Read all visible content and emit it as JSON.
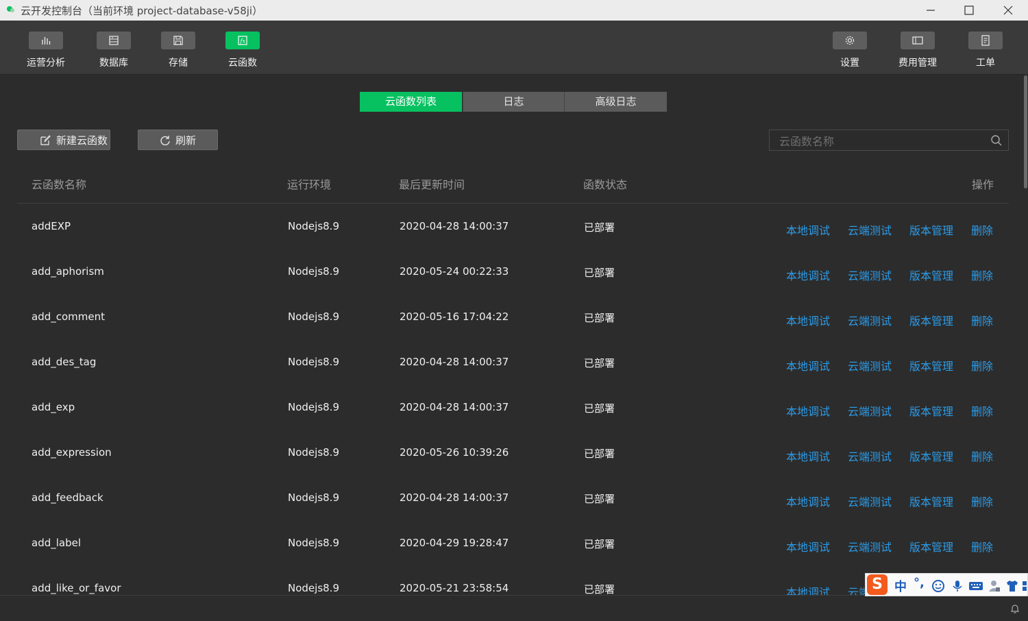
{
  "window": {
    "title": "云开发控制台（当前环境 project-database-v58ji）"
  },
  "toolbar": {
    "left_items": [
      {
        "label": "运营分析",
        "icon": "bar-chart-icon"
      },
      {
        "label": "数据库",
        "icon": "database-icon"
      },
      {
        "label": "存储",
        "icon": "storage-icon"
      },
      {
        "label": "云函数",
        "icon": "function-icon",
        "active": true
      }
    ],
    "right_items": [
      {
        "label": "设置",
        "icon": "gear-icon"
      },
      {
        "label": "费用管理",
        "icon": "billing-icon"
      },
      {
        "label": "工单",
        "icon": "ticket-icon"
      }
    ]
  },
  "tabs": [
    {
      "label": "云函数列表",
      "active": true
    },
    {
      "label": "日志"
    },
    {
      "label": "高级日志"
    }
  ],
  "actions": {
    "new_label": "新建云函数",
    "refresh_label": "刷新"
  },
  "search": {
    "placeholder": "云函数名称",
    "value": ""
  },
  "table": {
    "columns": [
      "云函数名称",
      "运行环境",
      "最后更新时间",
      "函数状态",
      "操作"
    ],
    "operations": [
      "本地调试",
      "云端测试",
      "版本管理",
      "删除"
    ],
    "rows": [
      {
        "name": "addEXP",
        "runtime": "Nodejs8.9",
        "updated": "2020-04-28 14:00:37",
        "status": "已部署"
      },
      {
        "name": "add_aphorism",
        "runtime": "Nodejs8.9",
        "updated": "2020-05-24 00:22:33",
        "status": "已部署"
      },
      {
        "name": "add_comment",
        "runtime": "Nodejs8.9",
        "updated": "2020-05-16 17:04:22",
        "status": "已部署"
      },
      {
        "name": "add_des_tag",
        "runtime": "Nodejs8.9",
        "updated": "2020-04-28 14:00:37",
        "status": "已部署"
      },
      {
        "name": "add_exp",
        "runtime": "Nodejs8.9",
        "updated": "2020-04-28 14:00:37",
        "status": "已部署"
      },
      {
        "name": "add_expression",
        "runtime": "Nodejs8.9",
        "updated": "2020-05-26 10:39:26",
        "status": "已部署"
      },
      {
        "name": "add_feedback",
        "runtime": "Nodejs8.9",
        "updated": "2020-04-28 14:00:37",
        "status": "已部署"
      },
      {
        "name": "add_label",
        "runtime": "Nodejs8.9",
        "updated": "2020-04-29 19:28:47",
        "status": "已部署"
      },
      {
        "name": "add_like_or_favor",
        "runtime": "Nodejs8.9",
        "updated": "2020-05-21 23:58:54",
        "status": "已部署"
      }
    ]
  },
  "ime": {
    "logo": "S",
    "mode": "中",
    "punct": "°,"
  },
  "colors": {
    "accent": "#07c160",
    "link": "#2b9be8",
    "background": "#2c2c2c"
  }
}
